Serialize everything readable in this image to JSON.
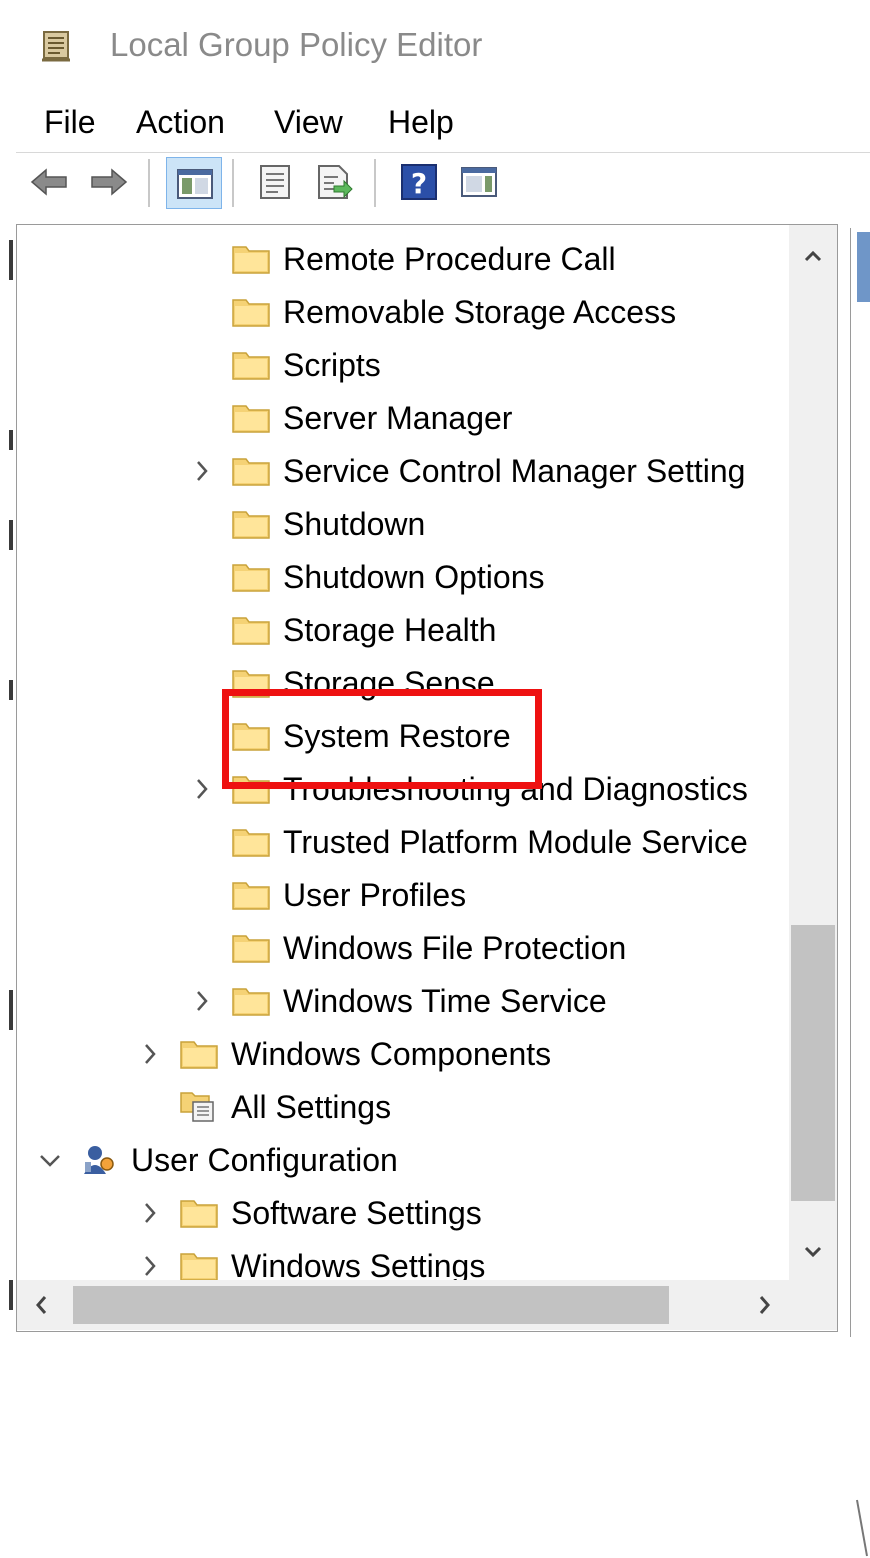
{
  "window": {
    "title": "Local Group Policy Editor",
    "title_icon": "policy-editor-icon"
  },
  "menu": [
    "File",
    "Action",
    "View",
    "Help"
  ],
  "toolbar": {
    "buttons": [
      "back-arrow-icon",
      "forward-arrow-icon",
      "show-hide-console-tree-icon",
      "properties-icon",
      "export-list-icon",
      "help-icon",
      "show-action-pane-icon"
    ]
  },
  "tree": {
    "items": [
      {
        "label": "Remote Procedure Call",
        "level": 3,
        "expandable": false,
        "icon": "folder-icon"
      },
      {
        "label": "Removable Storage Access",
        "level": 3,
        "expandable": false,
        "icon": "folder-icon"
      },
      {
        "label": "Scripts",
        "level": 3,
        "expandable": false,
        "icon": "folder-icon"
      },
      {
        "label": "Server Manager",
        "level": 3,
        "expandable": false,
        "icon": "folder-icon"
      },
      {
        "label": "Service Control Manager Setting",
        "level": 3,
        "expandable": true,
        "icon": "folder-icon"
      },
      {
        "label": "Shutdown",
        "level": 3,
        "expandable": false,
        "icon": "folder-icon"
      },
      {
        "label": "Shutdown Options",
        "level": 3,
        "expandable": false,
        "icon": "folder-icon"
      },
      {
        "label": "Storage Health",
        "level": 3,
        "expandable": false,
        "icon": "folder-icon"
      },
      {
        "label": "Storage Sense",
        "level": 3,
        "expandable": false,
        "icon": "folder-icon"
      },
      {
        "label": "System Restore",
        "level": 3,
        "expandable": false,
        "icon": "folder-icon",
        "highlighted": true
      },
      {
        "label": "Troubleshooting and Diagnostics",
        "level": 3,
        "expandable": true,
        "icon": "folder-icon"
      },
      {
        "label": "Trusted Platform Module Service",
        "level": 3,
        "expandable": false,
        "icon": "folder-icon"
      },
      {
        "label": "User Profiles",
        "level": 3,
        "expandable": false,
        "icon": "folder-icon"
      },
      {
        "label": "Windows File Protection",
        "level": 3,
        "expandable": false,
        "icon": "folder-icon"
      },
      {
        "label": "Windows Time Service",
        "level": 3,
        "expandable": true,
        "icon": "folder-icon"
      },
      {
        "label": "Windows Components",
        "level": 2,
        "expandable": true,
        "icon": "folder-icon"
      },
      {
        "label": "All Settings",
        "level": 2,
        "expandable": false,
        "icon": "all-settings-icon"
      },
      {
        "label": "User Configuration",
        "level": 1,
        "expandable": true,
        "expanded": true,
        "icon": "user-configuration-icon"
      },
      {
        "label": "Software Settings",
        "level": 2,
        "expandable": true,
        "icon": "folder-icon"
      },
      {
        "label": "Windows Settings",
        "level": 2,
        "expandable": true,
        "icon": "folder-icon"
      }
    ]
  },
  "colors": {
    "highlight_border": "#ee1111",
    "folder": "#f5d275",
    "scrollbar_thumb": "#c2c2c2"
  }
}
